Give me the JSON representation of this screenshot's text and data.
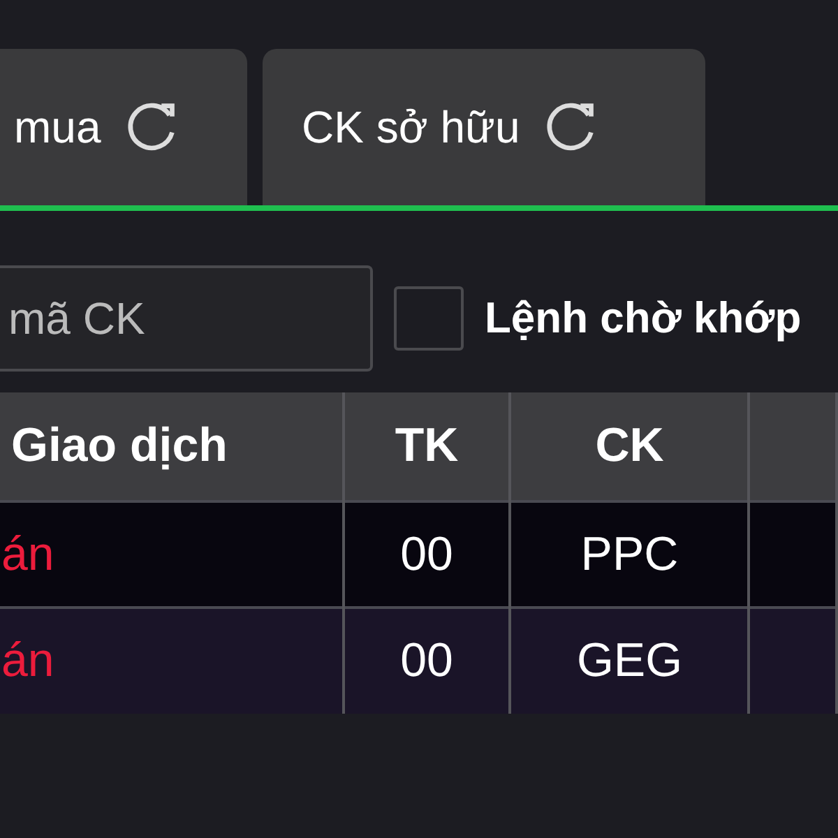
{
  "tabs": [
    {
      "label": "mua",
      "selected": false
    },
    {
      "label": "CK sở hữu",
      "selected": false
    }
  ],
  "filter": {
    "search": {
      "placeholder": "mã CK"
    },
    "pending_orders": {
      "label": "Lệnh chờ khớp",
      "checked": false
    }
  },
  "table": {
    "columns": [
      "Giao dịch",
      "TK",
      "CK"
    ],
    "rows": [
      {
        "cells": [
          "án",
          "00",
          "PPC"
        ],
        "color": "#ec1c3c"
      },
      {
        "cells": [
          "án",
          "00",
          "GEG"
        ],
        "color": "#ec1c3c"
      }
    ]
  }
}
